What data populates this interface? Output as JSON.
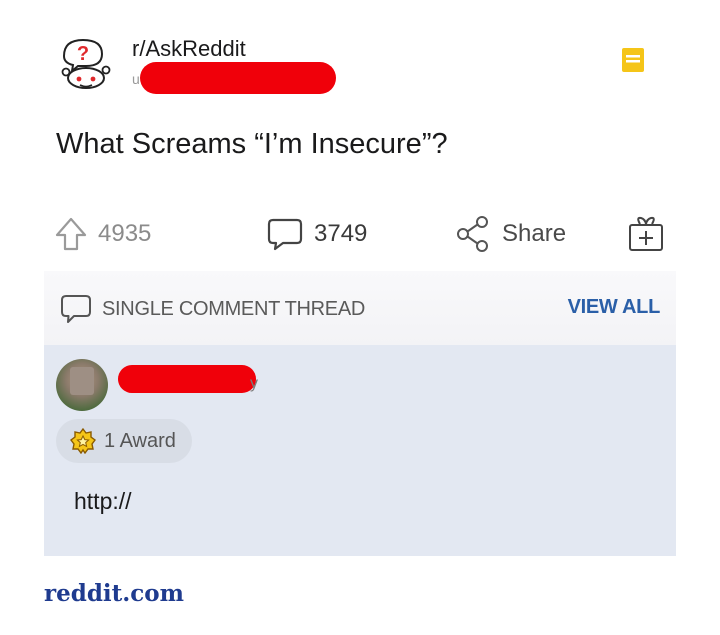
{
  "post": {
    "subreddit": "r/AskReddit",
    "user_prefix": "u",
    "title": "What Screams “I’m Insecure”?"
  },
  "actions": {
    "upvotes": "4935",
    "comments": "3749",
    "share_label": "Share"
  },
  "thread": {
    "label": "SINGLE COMMENT THREAD",
    "view_all": "VIEW ALL"
  },
  "comment": {
    "username_suffix": "y",
    "award_label": "1 Award",
    "text": "http://"
  },
  "footer": {
    "source": "reddit.com"
  },
  "colors": {
    "redaction": "#f0000a",
    "link_blue": "#2a5fa8",
    "save_yellow": "#f5c518",
    "comment_bg": "#e3e8f2"
  },
  "icons": [
    "subreddit-snoo-icon",
    "save-icon",
    "upvote-icon",
    "comment-icon",
    "share-icon",
    "gift-award-icon",
    "thread-comment-icon",
    "award-badge-icon"
  ]
}
